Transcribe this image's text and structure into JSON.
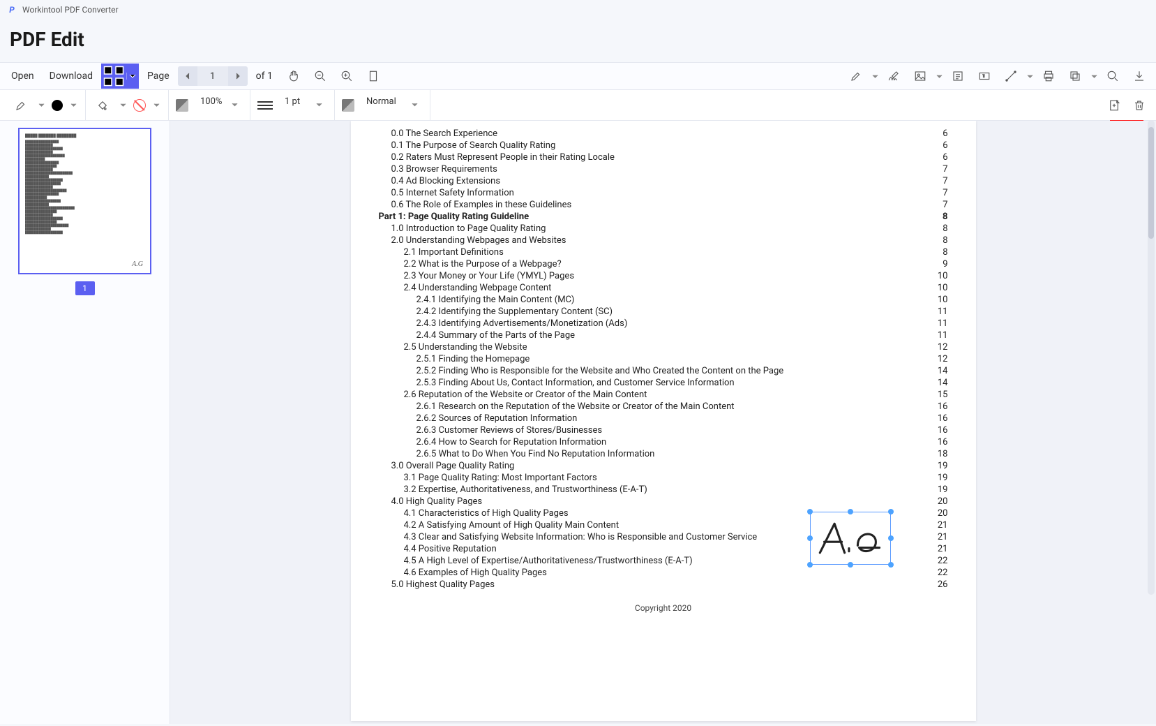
{
  "app": {
    "title": "Workintool PDF Converter"
  },
  "header": {
    "page_title": "PDF Edit"
  },
  "toolbar1": {
    "open": "Open",
    "download": "Download",
    "page_label": "Page",
    "page_current": "1",
    "page_of": "of 1"
  },
  "toolbar2": {
    "zoom": "100%",
    "stroke_width": "1 pt",
    "opacity_mode": "Normal"
  },
  "thumbs": {
    "p1_num": "1"
  },
  "toc": {
    "rows": [
      {
        "lvl": 1,
        "t": "0.0 The Search Experience",
        "p": "6"
      },
      {
        "lvl": 1,
        "t": "0.1 The Purpose of Search Quality Rating",
        "p": "6"
      },
      {
        "lvl": 1,
        "t": "0.2 Raters Must Represent People in their Rating Locale",
        "p": "6"
      },
      {
        "lvl": 1,
        "t": "0.3 Browser Requirements",
        "p": "7"
      },
      {
        "lvl": 1,
        "t": "0.4 Ad Blocking Extensions",
        "p": "7"
      },
      {
        "lvl": 1,
        "t": "0.5 Internet Safety Information",
        "p": "7"
      },
      {
        "lvl": 1,
        "t": "0.6 The Role of Examples in these Guidelines",
        "p": "7"
      },
      {
        "lvl": 0,
        "t": "Part 1: Page Quality Rating Guideline",
        "p": "8"
      },
      {
        "lvl": 1,
        "t": "1.0 Introduction to Page Quality Rating",
        "p": "8"
      },
      {
        "lvl": 1,
        "t": "2.0 Understanding Webpages and Websites",
        "p": "8"
      },
      {
        "lvl": 2,
        "t": "2.1 Important Definitions",
        "p": "8"
      },
      {
        "lvl": 2,
        "t": "2.2 What is the Purpose of a Webpage?",
        "p": "9"
      },
      {
        "lvl": 2,
        "t": "2.3 Your Money or Your Life (YMYL) Pages",
        "p": "10"
      },
      {
        "lvl": 2,
        "t": "2.4 Understanding Webpage Content",
        "p": "10"
      },
      {
        "lvl": 3,
        "t": "2.4.1 Identifying the Main Content (MC)",
        "p": "10"
      },
      {
        "lvl": 3,
        "t": "2.4.2 Identifying the Supplementary Content (SC)",
        "p": "11"
      },
      {
        "lvl": 3,
        "t": "2.4.3 Identifying Advertisements/Monetization (Ads)",
        "p": "11"
      },
      {
        "lvl": 3,
        "t": "2.4.4 Summary of the Parts of the Page",
        "p": "11"
      },
      {
        "lvl": 2,
        "t": "2.5 Understanding the Website",
        "p": "12"
      },
      {
        "lvl": 3,
        "t": "2.5.1 Finding the Homepage",
        "p": "12"
      },
      {
        "lvl": 3,
        "t": "2.5.2 Finding Who is Responsible for the Website and Who Created the Content on the Page",
        "p": "14"
      },
      {
        "lvl": 3,
        "t": "2.5.3 Finding About Us, Contact Information, and Customer Service Information",
        "p": "14"
      },
      {
        "lvl": 2,
        "t": "2.6 Reputation of the Website or Creator of the Main Content",
        "p": "15"
      },
      {
        "lvl": 3,
        "t": "2.6.1 Research on the Reputation of the Website or Creator of the Main Content",
        "p": "16"
      },
      {
        "lvl": 3,
        "t": "2.6.2 Sources of Reputation Information",
        "p": "16"
      },
      {
        "lvl": 3,
        "t": "2.6.3 Customer Reviews of Stores/Businesses",
        "p": "16"
      },
      {
        "lvl": 3,
        "t": "2.6.4 How to Search for Reputation Information",
        "p": "16"
      },
      {
        "lvl": 3,
        "t": "2.6.5 What to Do When You Find No Reputation Information",
        "p": "18"
      },
      {
        "lvl": 1,
        "t": "3.0 Overall Page Quality Rating",
        "p": "19"
      },
      {
        "lvl": 2,
        "t": "3.1 Page Quality Rating: Most Important Factors",
        "p": "19"
      },
      {
        "lvl": 2,
        "t": "3.2 Expertise, Authoritativeness, and Trustworthiness (E-A-T)",
        "p": "19"
      },
      {
        "lvl": 1,
        "t": "4.0 High Quality Pages",
        "p": "20"
      },
      {
        "lvl": 2,
        "t": "4.1 Characteristics of High Quality Pages",
        "p": "20"
      },
      {
        "lvl": 2,
        "t": "4.2 A Satisfying Amount of High Quality Main Content",
        "p": "21"
      },
      {
        "lvl": 2,
        "t": "4.3 Clear and Satisfying Website Information: Who is Responsible and Customer Service",
        "p": "21"
      },
      {
        "lvl": 2,
        "t": "4.4 Positive Reputation",
        "p": "21"
      },
      {
        "lvl": 2,
        "t": "4.5 A High Level of Expertise/Authoritativeness/Trustworthiness (E-A-T)",
        "p": "22"
      },
      {
        "lvl": 2,
        "t": "4.6 Examples of High Quality Pages",
        "p": "22"
      },
      {
        "lvl": 1,
        "t": "5.0 Highest Quality Pages",
        "p": "26"
      }
    ],
    "copyright": "Copyright 2020"
  },
  "signature": {
    "text": "A.G"
  },
  "colors": {
    "accent": "#5b5ff1",
    "highlight": "#ff1a1a"
  }
}
